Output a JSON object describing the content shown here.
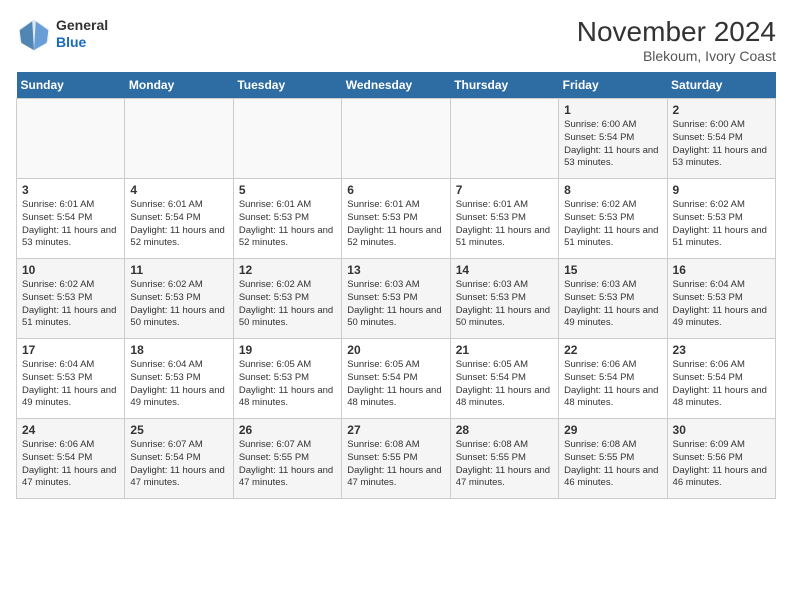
{
  "header": {
    "logo_general": "General",
    "logo_blue": "Blue",
    "title": "November 2024",
    "subtitle": "Blekoum, Ivory Coast"
  },
  "weekdays": [
    "Sunday",
    "Monday",
    "Tuesday",
    "Wednesday",
    "Thursday",
    "Friday",
    "Saturday"
  ],
  "weeks": [
    [
      {
        "day": "",
        "info": ""
      },
      {
        "day": "",
        "info": ""
      },
      {
        "day": "",
        "info": ""
      },
      {
        "day": "",
        "info": ""
      },
      {
        "day": "",
        "info": ""
      },
      {
        "day": "1",
        "info": "Sunrise: 6:00 AM\nSunset: 5:54 PM\nDaylight: 11 hours and 53 minutes."
      },
      {
        "day": "2",
        "info": "Sunrise: 6:00 AM\nSunset: 5:54 PM\nDaylight: 11 hours and 53 minutes."
      }
    ],
    [
      {
        "day": "3",
        "info": "Sunrise: 6:01 AM\nSunset: 5:54 PM\nDaylight: 11 hours and 53 minutes."
      },
      {
        "day": "4",
        "info": "Sunrise: 6:01 AM\nSunset: 5:54 PM\nDaylight: 11 hours and 52 minutes."
      },
      {
        "day": "5",
        "info": "Sunrise: 6:01 AM\nSunset: 5:53 PM\nDaylight: 11 hours and 52 minutes."
      },
      {
        "day": "6",
        "info": "Sunrise: 6:01 AM\nSunset: 5:53 PM\nDaylight: 11 hours and 52 minutes."
      },
      {
        "day": "7",
        "info": "Sunrise: 6:01 AM\nSunset: 5:53 PM\nDaylight: 11 hours and 51 minutes."
      },
      {
        "day": "8",
        "info": "Sunrise: 6:02 AM\nSunset: 5:53 PM\nDaylight: 11 hours and 51 minutes."
      },
      {
        "day": "9",
        "info": "Sunrise: 6:02 AM\nSunset: 5:53 PM\nDaylight: 11 hours and 51 minutes."
      }
    ],
    [
      {
        "day": "10",
        "info": "Sunrise: 6:02 AM\nSunset: 5:53 PM\nDaylight: 11 hours and 51 minutes."
      },
      {
        "day": "11",
        "info": "Sunrise: 6:02 AM\nSunset: 5:53 PM\nDaylight: 11 hours and 50 minutes."
      },
      {
        "day": "12",
        "info": "Sunrise: 6:02 AM\nSunset: 5:53 PM\nDaylight: 11 hours and 50 minutes."
      },
      {
        "day": "13",
        "info": "Sunrise: 6:03 AM\nSunset: 5:53 PM\nDaylight: 11 hours and 50 minutes."
      },
      {
        "day": "14",
        "info": "Sunrise: 6:03 AM\nSunset: 5:53 PM\nDaylight: 11 hours and 50 minutes."
      },
      {
        "day": "15",
        "info": "Sunrise: 6:03 AM\nSunset: 5:53 PM\nDaylight: 11 hours and 49 minutes."
      },
      {
        "day": "16",
        "info": "Sunrise: 6:04 AM\nSunset: 5:53 PM\nDaylight: 11 hours and 49 minutes."
      }
    ],
    [
      {
        "day": "17",
        "info": "Sunrise: 6:04 AM\nSunset: 5:53 PM\nDaylight: 11 hours and 49 minutes."
      },
      {
        "day": "18",
        "info": "Sunrise: 6:04 AM\nSunset: 5:53 PM\nDaylight: 11 hours and 49 minutes."
      },
      {
        "day": "19",
        "info": "Sunrise: 6:05 AM\nSunset: 5:53 PM\nDaylight: 11 hours and 48 minutes."
      },
      {
        "day": "20",
        "info": "Sunrise: 6:05 AM\nSunset: 5:54 PM\nDaylight: 11 hours and 48 minutes."
      },
      {
        "day": "21",
        "info": "Sunrise: 6:05 AM\nSunset: 5:54 PM\nDaylight: 11 hours and 48 minutes."
      },
      {
        "day": "22",
        "info": "Sunrise: 6:06 AM\nSunset: 5:54 PM\nDaylight: 11 hours and 48 minutes."
      },
      {
        "day": "23",
        "info": "Sunrise: 6:06 AM\nSunset: 5:54 PM\nDaylight: 11 hours and 48 minutes."
      }
    ],
    [
      {
        "day": "24",
        "info": "Sunrise: 6:06 AM\nSunset: 5:54 PM\nDaylight: 11 hours and 47 minutes."
      },
      {
        "day": "25",
        "info": "Sunrise: 6:07 AM\nSunset: 5:54 PM\nDaylight: 11 hours and 47 minutes."
      },
      {
        "day": "26",
        "info": "Sunrise: 6:07 AM\nSunset: 5:55 PM\nDaylight: 11 hours and 47 minutes."
      },
      {
        "day": "27",
        "info": "Sunrise: 6:08 AM\nSunset: 5:55 PM\nDaylight: 11 hours and 47 minutes."
      },
      {
        "day": "28",
        "info": "Sunrise: 6:08 AM\nSunset: 5:55 PM\nDaylight: 11 hours and 47 minutes."
      },
      {
        "day": "29",
        "info": "Sunrise: 6:08 AM\nSunset: 5:55 PM\nDaylight: 11 hours and 46 minutes."
      },
      {
        "day": "30",
        "info": "Sunrise: 6:09 AM\nSunset: 5:56 PM\nDaylight: 11 hours and 46 minutes."
      }
    ]
  ]
}
